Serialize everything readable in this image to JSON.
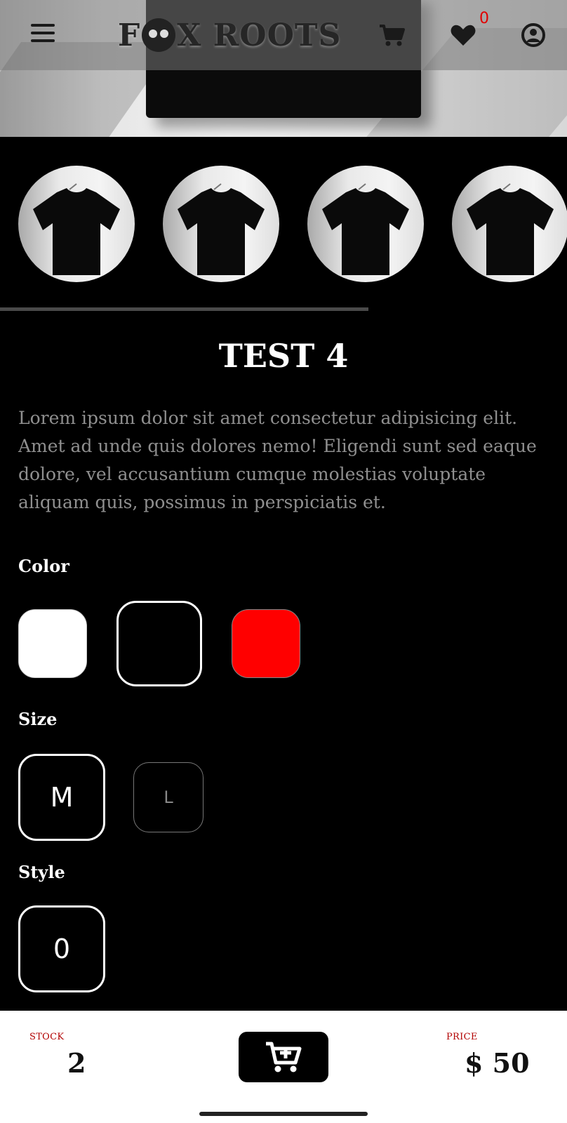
{
  "header": {
    "logo_left": "F",
    "logo_right": "X ROOTS",
    "wishlist_count": "0",
    "icons": [
      "menu-icon",
      "cart-icon",
      "heart-icon",
      "user-icon"
    ]
  },
  "gallery": {
    "thumbnail_count": 4,
    "progress_fraction": 0.65
  },
  "product": {
    "title": "TEST 4",
    "description": "Lorem ipsum dolor sit amet consectetur adipisicing elit. Amet ad unde quis dolores nemo! Eligendi sunt sed eaque dolore, vel accusantium cumque molestias voluptate aliquam quis, possimus in perspiciatis et."
  },
  "options": {
    "color_label": "Color",
    "colors": [
      {
        "hex": "#ffffff",
        "selected": false
      },
      {
        "hex": "#000000",
        "selected": true
      },
      {
        "hex": "#ff0000",
        "selected": false
      }
    ],
    "size_label": "Size",
    "sizes": [
      {
        "label": "M",
        "selected": true
      },
      {
        "label": "L",
        "selected": false
      }
    ],
    "style_label": "Style",
    "styles": [
      {
        "label": "0",
        "selected": true
      }
    ]
  },
  "bottom_bar": {
    "stock_label": "STOCK",
    "stock_value": "2",
    "price_label": "PRICE",
    "price_value": "$ 50"
  },
  "colors": {
    "accent_red": "#e10000",
    "label_red": "#b20000",
    "background": "#000000",
    "muted_text": "#8f8f8f"
  }
}
